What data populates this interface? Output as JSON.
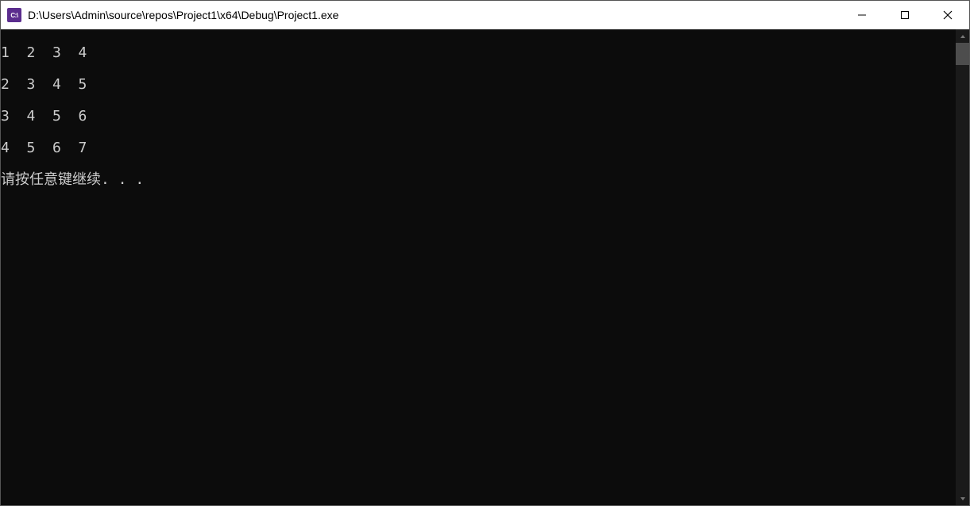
{
  "window": {
    "icon_label": "C:\\",
    "title": "D:\\Users\\Admin\\source\\repos\\Project1\\x64\\Debug\\Project1.exe"
  },
  "console": {
    "lines": [
      "1  2  3  4",
      "2  3  4  5",
      "3  4  5  6",
      "4  5  6  7",
      "请按任意键继续. . ."
    ]
  }
}
